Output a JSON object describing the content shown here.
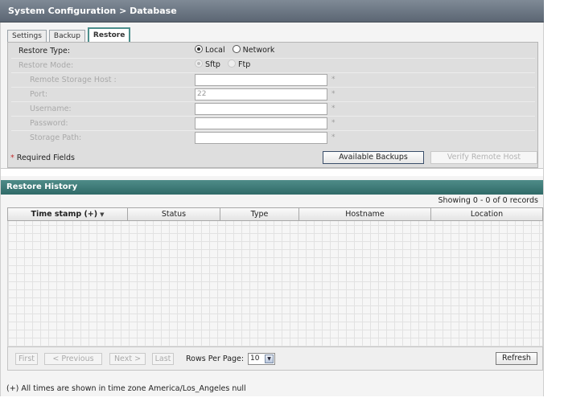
{
  "header": {
    "title": "System Configuration > Database"
  },
  "tabs": [
    {
      "label": "Settings",
      "active": false
    },
    {
      "label": "Backup",
      "active": false
    },
    {
      "label": "Restore",
      "active": true
    }
  ],
  "form": {
    "restore_type": {
      "label": "Restore Type:",
      "options": [
        "Local",
        "Network"
      ],
      "selected": "Local"
    },
    "restore_mode": {
      "label": "Restore Mode:",
      "options": [
        "Sftp",
        "Ftp"
      ],
      "selected": "Sftp",
      "disabled": true
    },
    "remote_host": {
      "label": "Remote Storage Host :",
      "value": ""
    },
    "port": {
      "label": "Port:",
      "value": "22"
    },
    "username": {
      "label": "Username:",
      "value": ""
    },
    "password": {
      "label": "Password:",
      "value": ""
    },
    "storage_path": {
      "label": "Storage Path:",
      "value": ""
    },
    "required_marker": "*",
    "required_note": "Required Fields",
    "available_backups_label": "Available Backups",
    "verify_remote_host_label": "Verify Remote Host"
  },
  "history": {
    "title": "Restore History",
    "showing": "Showing 0 - 0 of 0 records",
    "columns": [
      "Time stamp (+)",
      "Status",
      "Type",
      "Hostname",
      "Location"
    ],
    "sorted_column": "Time stamp (+)",
    "rows": []
  },
  "pager": {
    "first": "First",
    "previous": "< Previous",
    "next": "Next >",
    "last": "Last",
    "rows_per_page_label": "Rows Per Page:",
    "rows_per_page_value": "10",
    "refresh": "Refresh"
  },
  "footnote": "(+) All times are shown in time zone America/Los_Angeles null"
}
